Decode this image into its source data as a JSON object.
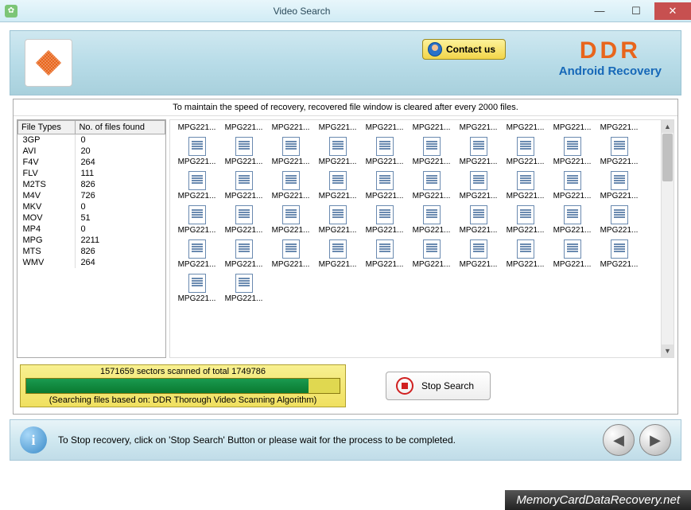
{
  "window": {
    "title": "Video Search"
  },
  "header": {
    "contact_label": "Contact us",
    "brand": "DDR",
    "subtitle": "Android Recovery"
  },
  "info_strip": "To maintain the speed of recovery, recovered file window is cleared after every 2000 files.",
  "file_types": {
    "col1_header": "File Types",
    "col2_header": "No. of files found",
    "rows": [
      {
        "type": "3GP",
        "count": "0"
      },
      {
        "type": "AVI",
        "count": "20"
      },
      {
        "type": "F4V",
        "count": "264"
      },
      {
        "type": "FLV",
        "count": "111"
      },
      {
        "type": "M2TS",
        "count": "826"
      },
      {
        "type": "M4V",
        "count": "726"
      },
      {
        "type": "MKV",
        "count": "0"
      },
      {
        "type": "MOV",
        "count": "51"
      },
      {
        "type": "MP4",
        "count": "0"
      },
      {
        "type": "MPG",
        "count": "2211"
      },
      {
        "type": "MTS",
        "count": "826"
      },
      {
        "type": "WMV",
        "count": "264"
      }
    ]
  },
  "grid_item_label": "MPG221...",
  "progress": {
    "scanned_text": "1571659 sectors scanned of total 1749786",
    "algo_text": "(Searching files based on:  DDR Thorough Video Scanning Algorithm)"
  },
  "stop_button_label": "Stop Search",
  "footer": {
    "tip": "To Stop recovery, click on 'Stop Search' Button or please wait for the process to be completed."
  },
  "watermark": "MemoryCardDataRecovery.net"
}
